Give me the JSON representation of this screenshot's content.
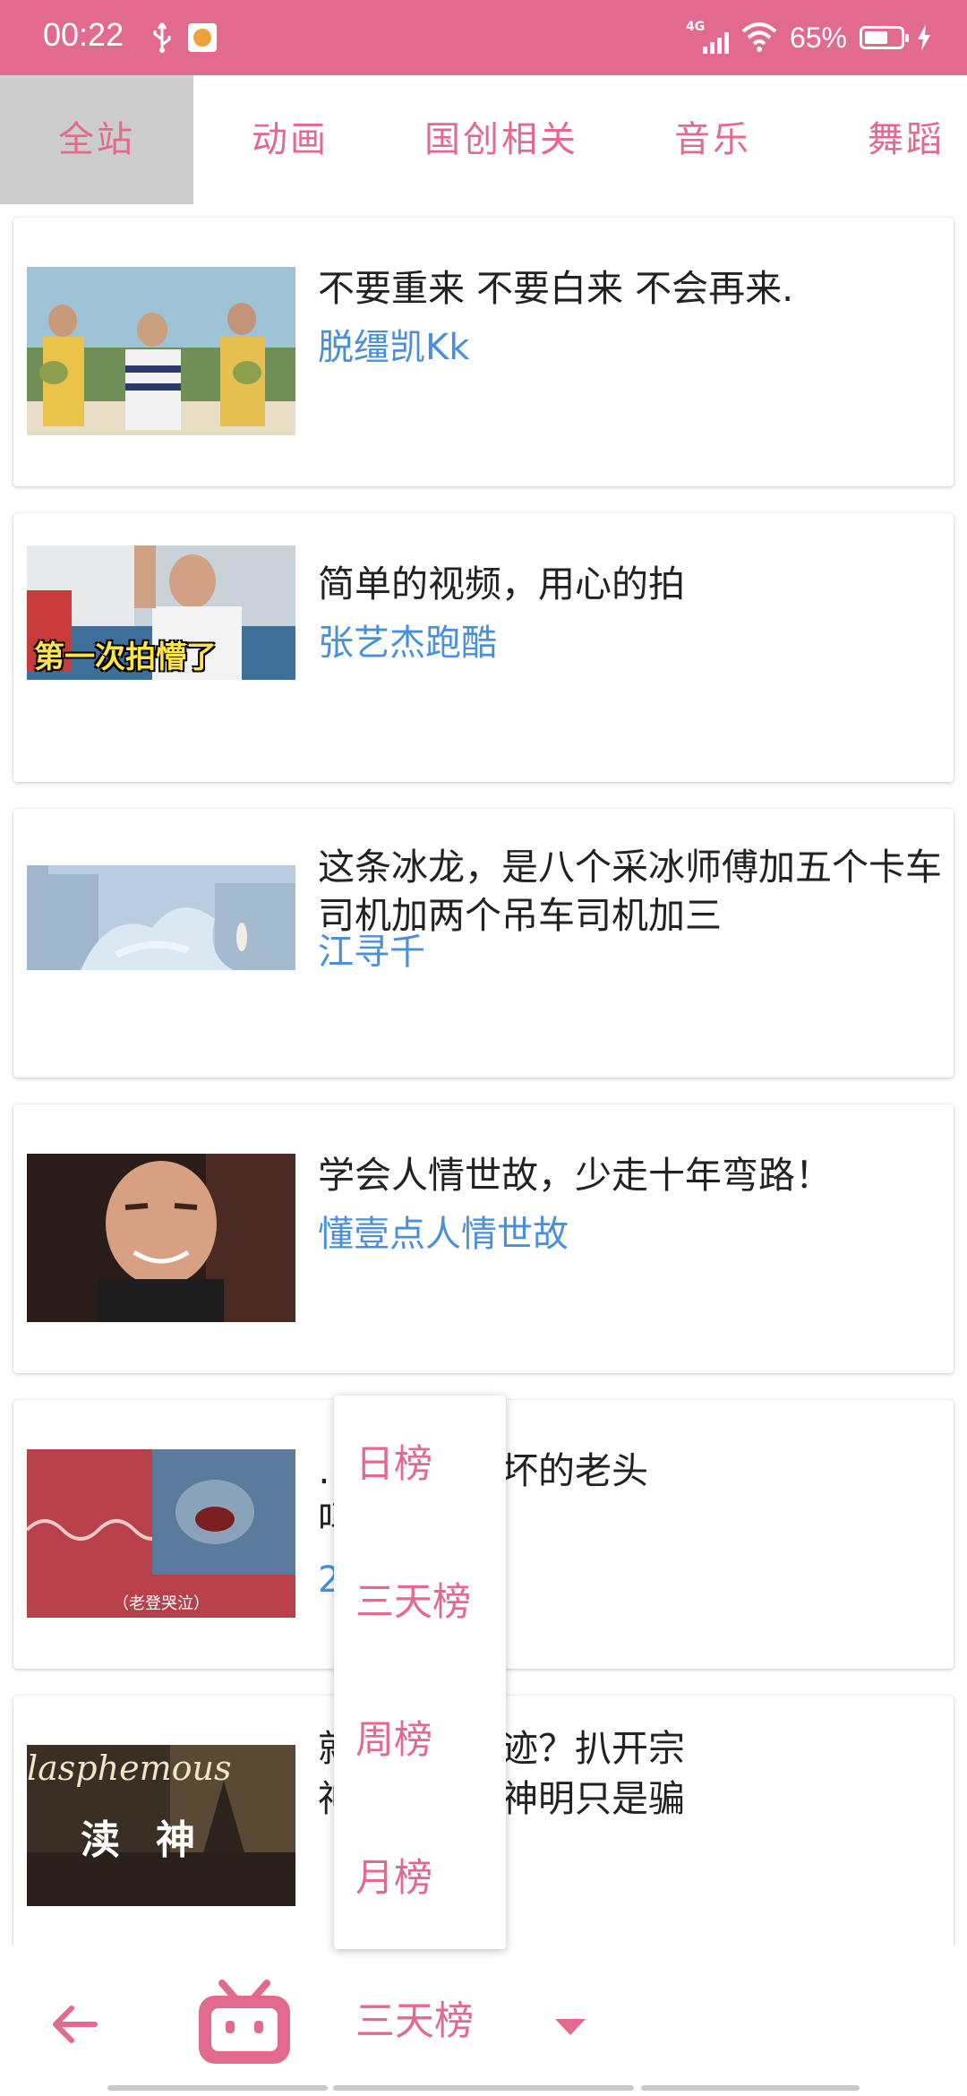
{
  "status_bar": {
    "time": "00:22",
    "network": "4G",
    "battery_percent": "65%",
    "battery_level": 0.65,
    "icons": [
      "usb-icon",
      "app-notification-icon",
      "signal-icon",
      "wifi-icon",
      "battery-icon",
      "charging-icon"
    ]
  },
  "colors": {
    "accent": "#e26a8e",
    "author": "#4a90d9",
    "tab_active_bg": "#cdcdcd"
  },
  "tabs": [
    {
      "label": "全站",
      "active": true
    },
    {
      "label": "动画",
      "active": false
    },
    {
      "label": "国创相关",
      "active": false
    },
    {
      "label": "音乐",
      "active": false
    },
    {
      "label": "舞蹈",
      "active": false
    }
  ],
  "videos": [
    {
      "title": "不要重来 不要白来 不会再来.",
      "author": "脱缰凯Kk"
    },
    {
      "title": "简单的视频，用心的拍",
      "author": "张艺杰跑酷",
      "thumb_text": "第一次拍懵了"
    },
    {
      "title": "这条冰龙，是八个采冰师傅加五个卡车司机加两个吊车司机加三",
      "author": "江寻千"
    },
    {
      "title": "学会人情世故，少走十年弯路！",
      "author": "懂壹点人情世故"
    },
    {
      "title": "…是什么很坏的老头",
      "title_line2": "吗",
      "author": "22",
      "thumb_text": "（老登哭泣）"
    },
    {
      "title": "就能获得奇迹？扒开宗",
      "title_line2": "神作，所谓神明只是骗",
      "thumb_text": "lasphemous",
      "thumb_sub": "渎神"
    }
  ],
  "rank_menu": {
    "items": [
      "日榜",
      "三天榜",
      "周榜",
      "月榜"
    ]
  },
  "bottom_bar": {
    "selected_rank": "三天榜",
    "icons": [
      "back-arrow-icon",
      "bilibili-tv-icon",
      "caret-down-icon"
    ]
  }
}
